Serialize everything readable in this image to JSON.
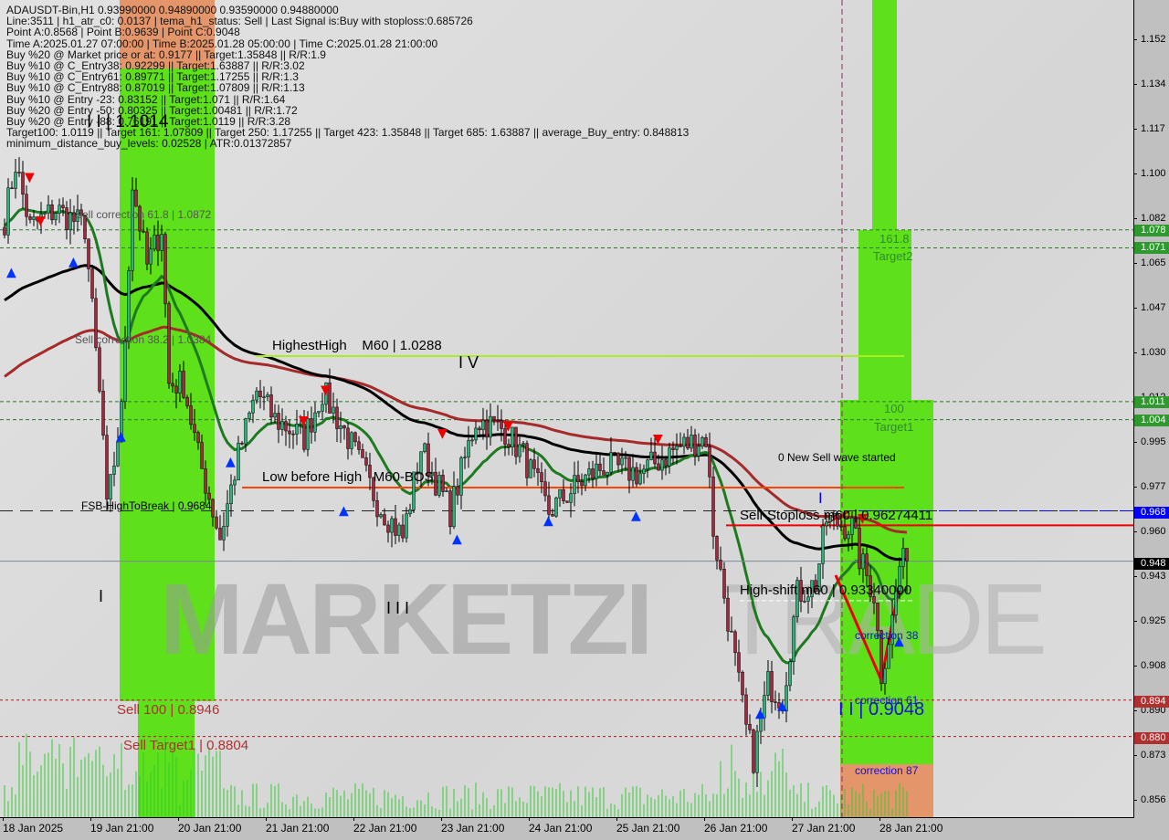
{
  "header": {
    "lines": [
      "ADAUSDT-Bin,H1  0.93990000 0.94890000 0.93590000 0.94880000",
      "Line:3511 | h1_atr_c0: 0.0137 | tema_h1_status: Sell | Last Signal is:Buy with stoploss:0.685726",
      "Point A:0.8568 | Point B:0.9639 | Point C:0.9048",
      "Time A:2025.01.27 07:00:00 | Time B:2025.01.28 05:00:00 | Time C:2025.01.28 21:00:00",
      "Buy %20 @ Market price or at: 0.9177 || Target:1.35848 || R/R:1.9",
      "Buy %10 @ C_Entry38: 0.92299 || Target:1.63887 || R/R:3.02",
      "Buy %10 @ C_Entry61: 0.89771 || Target:1.17255 || R/R:1.3",
      "Buy %10 @ C_Entry88: 0.87019 || Target:1.07809 || R/R:1.13",
      "Buy %10 @ Entry -23: 0.83152 || Target:1.071 || R/R:1.64",
      "Buy %20 @ Entry -50: 0.80325 || Target:1.00481 || R/R:1.72",
      "Buy %20 @ Entry -88: 0.76191 || Target:1.0119 || R/R:3.28",
      "Target100: 1.0119 || Target 161: 1.07809 || Target 250: 1.17255 || Target 423: 1.35848 || Target 685: 1.63887 || average_Buy_entry: 0.848813",
      "minimum_distance_buy_levels: 0.02528 | ATR:0.01372857"
    ]
  },
  "labels": {
    "wave_ii_left": "I I | 1.1014",
    "sell_corr_618": "Sell correction 61.8 | 1.0872",
    "sell_corr_382": "Sell correction 38.2 | 1.0384",
    "highest_high": "HighestHigh    M60 | 1.0288",
    "wave_iv": "I V",
    "low_before_high": "Low before High   M60-BOS",
    "fsb_high": "FSB-HighToBreak | 0.9684",
    "wave_i": "I",
    "wave_iii": "I I I",
    "sell_100": "Sell 100 | 0.8946",
    "sell_target1": "Sell Target1 | 0.8804",
    "t2_level": "161.8",
    "t2_name": "Target2",
    "t1_level": "100",
    "t1_name": "Target1",
    "new_sell_wave": "0 New Sell wave started",
    "wave_i_right": "I",
    "sell_stoploss": "Sell-Stoploss m60 | 0.96274411",
    "high_shift": "High-shift m60 | 0.93340000",
    "corr_38": "correction 38",
    "corr_61": "correction 61",
    "wave_ii_right": "I I | 0.9048",
    "corr_87": "correction 87"
  },
  "watermark": {
    "brand": "MARKETZI",
    "suffix": "TRADE"
  },
  "y_axis": [
    "1.152",
    "1.134",
    "1.117",
    "1.100",
    "1.082",
    "1.065",
    "1.047",
    "1.030",
    "1.012",
    "0.995",
    "0.977",
    "0.960",
    "0.943",
    "0.925",
    "0.908",
    "0.890",
    "0.873",
    "0.856"
  ],
  "price_tags": [
    {
      "text": "1.078",
      "color": "#2e9a2e"
    },
    {
      "text": "1.071",
      "color": "#2e9a2e"
    },
    {
      "text": "1.011",
      "color": "#2e9a2e"
    },
    {
      "text": "1.004",
      "color": "#2e9a2e"
    },
    {
      "text": "0.968",
      "color": "#0000ff"
    },
    {
      "text": "0.948",
      "color": "#000000"
    },
    {
      "text": "0.894",
      "color": "#b03030"
    },
    {
      "text": "0.880",
      "color": "#b03030"
    }
  ],
  "x_axis": [
    "18 Jan 2025",
    "19 Jan 21:00",
    "20 Jan 21:00",
    "21 Jan 21:00",
    "22 Jan 21:00",
    "23 Jan 21:00",
    "24 Jan 21:00",
    "25 Jan 21:00",
    "26 Jan 21:00",
    "27 Jan 21:00",
    "28 Jan 21:00"
  ],
  "colors": {
    "bull": "#2db37a",
    "bear": "#a3293f",
    "ma_fast": "#1e7a1e",
    "ma_mid": "#000000",
    "ma_slow": "#a52a2a",
    "zone_green": "#5ee01a",
    "zone_orange": "#e4966a",
    "volume": "#33cc33"
  },
  "chart_data": {
    "type": "candlestick",
    "symbol": "ADAUSDT-Bin",
    "timeframe": "H1",
    "ylim": [
      0.849,
      1.167
    ],
    "last": {
      "open": 0.9399,
      "high": 0.9489,
      "low": 0.9359,
      "close": 0.9488
    },
    "approx_close_path": [
      [
        "01-18 21:00",
        1.082
      ],
      [
        "01-19 00:00",
        1.104
      ],
      [
        "01-19 04:00",
        1.079
      ],
      [
        "01-19 11:00",
        1.086
      ],
      [
        "01-19 19:00",
        1.079
      ],
      [
        "01-20 00:00",
        0.997
      ],
      [
        "01-20 01:00",
        0.968
      ],
      [
        "01-20 05:00",
        1.007
      ],
      [
        "01-20 08:00",
        1.096
      ],
      [
        "01-20 12:00",
        1.064
      ],
      [
        "01-20 16:00",
        1.079
      ],
      [
        "01-20 18:00",
        1.018
      ],
      [
        "01-20 22:00",
        1.018
      ],
      [
        "01-21 02:00",
        0.99
      ],
      [
        "01-21 08:00",
        0.958
      ],
      [
        "01-21 13:00",
        0.99
      ],
      [
        "01-21 18:00",
        1.015
      ],
      [
        "01-21 23:00",
        1.004
      ],
      [
        "01-22 07:00",
        0.997
      ],
      [
        "01-22 12:00",
        1.015
      ],
      [
        "01-22 19:00",
        0.997
      ],
      [
        "01-23 03:00",
        0.972
      ],
      [
        "01-23 10:00",
        0.958
      ],
      [
        "01-23 15:00",
        0.993
      ],
      [
        "01-23 23:00",
        0.968
      ],
      [
        "01-24 06:00",
        1.004
      ],
      [
        "01-24 14:00",
        1.0
      ],
      [
        "01-24 19:00",
        0.99
      ],
      [
        "01-25 02:00",
        0.968
      ],
      [
        "01-25 10:00",
        0.979
      ],
      [
        "01-25 17:00",
        0.986
      ],
      [
        "01-26 03:00",
        0.983
      ],
      [
        "01-26 13:00",
        0.993
      ],
      [
        "01-26 21:00",
        0.997
      ],
      [
        "01-26 23:00",
        0.961
      ],
      [
        "01-27 04:00",
        0.918
      ],
      [
        "01-27 08:00",
        0.883
      ],
      [
        "01-27 10:00",
        0.872
      ],
      [
        "01-27 14:00",
        0.901
      ],
      [
        "01-27 18:00",
        0.895
      ],
      [
        "01-27 22:00",
        0.936
      ],
      [
        "01-28 03:00",
        0.94
      ],
      [
        "01-28 06:00",
        0.965
      ],
      [
        "01-28 13:00",
        0.962
      ],
      [
        "01-28 15:00",
        0.95
      ],
      [
        "01-28 19:00",
        0.936
      ],
      [
        "01-28 21:00",
        0.905
      ],
      [
        "01-29 00:00",
        0.926
      ],
      [
        "01-29 02:00",
        0.947
      ],
      [
        "01-29 04:00",
        0.9488
      ]
    ],
    "levels": {
      "target2_161": 1.078,
      "target_1071": 1.071,
      "target1_100": 1.011,
      "level_1004": 1.004,
      "fsb_high": 0.9684,
      "sell_stoploss": 0.96274411,
      "low_before_high": 0.9775,
      "highest_high": 1.0288,
      "high_shift": 0.9334,
      "current": 0.9488,
      "sell_100": 0.8946,
      "sell_target1": 0.8804
    }
  }
}
